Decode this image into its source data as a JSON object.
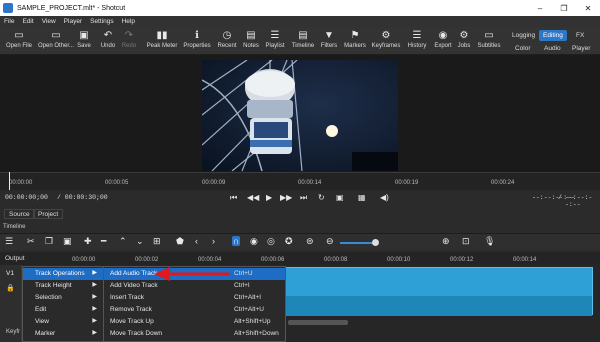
{
  "window": {
    "title": "SAMPLE_PROJECT.mlt* - Shotcut",
    "controls": [
      "–",
      "❐",
      "✕"
    ]
  },
  "menubar": [
    "File",
    "Edit",
    "View",
    "Player",
    "Settings",
    "Help"
  ],
  "toolbar": [
    {
      "label": "Open File",
      "icon": "folder-icon",
      "glyph": "▭"
    },
    {
      "label": "Open Other...",
      "icon": "open-other-icon",
      "glyph": "▭"
    },
    {
      "label": "Save",
      "icon": "save-icon",
      "glyph": "▣"
    },
    {
      "label": "Undo",
      "icon": "undo-icon",
      "glyph": "↶"
    },
    {
      "label": "Redo",
      "icon": "redo-icon",
      "glyph": "↷",
      "disabled": true
    },
    {
      "label": "Peak Meter",
      "icon": "peak-meter-icon",
      "glyph": "▮▮"
    },
    {
      "label": "Properties",
      "icon": "info-icon",
      "glyph": "ℹ"
    },
    {
      "label": "Recent",
      "icon": "clock-icon",
      "glyph": "◷"
    },
    {
      "label": "Notes",
      "icon": "notes-icon",
      "glyph": "▤"
    },
    {
      "label": "Playlist",
      "icon": "playlist-icon",
      "glyph": "☰"
    },
    {
      "label": "Timeline",
      "icon": "timeline-icon",
      "glyph": "▤"
    },
    {
      "label": "Filters",
      "icon": "filter-icon",
      "glyph": "▼"
    },
    {
      "label": "Markers",
      "icon": "marker-icon",
      "glyph": "⚑"
    },
    {
      "label": "Keyframes",
      "icon": "keyframes-icon",
      "glyph": "⚙"
    },
    {
      "label": "History",
      "icon": "history-icon",
      "glyph": "☰"
    },
    {
      "label": "Export",
      "icon": "export-icon",
      "glyph": "◉"
    },
    {
      "label": "Jobs",
      "icon": "gear-icon",
      "glyph": "⚙"
    },
    {
      "label": "Subtitles",
      "icon": "subtitles-icon",
      "glyph": "▭"
    }
  ],
  "layouts": {
    "top": [
      "Logging",
      "Editing",
      "FX"
    ],
    "active": "Editing",
    "bottom": [
      "Color",
      "Audio",
      "Player"
    ]
  },
  "ruler": {
    "ticks": [
      "00:00:00",
      "00:00:05",
      "00:00:09",
      "00:00:14",
      "00:00:19",
      "00:00:24"
    ]
  },
  "transport": {
    "position": "00:00:00;00",
    "duration": "/ 00:00:30;00",
    "in_point": "--:--:--:--",
    "out_point": "--:--:--:--",
    "separator": "/"
  },
  "source_tabs": [
    "Source",
    "Project"
  ],
  "timeline": {
    "label": "Timeline",
    "output_label": "Output",
    "track_name": "V1",
    "keyframes_label": "Keyfr",
    "ticks": [
      "00:00:00",
      "00:00:02",
      "00:00:04",
      "00:00:06",
      "00:00:08",
      "00:00:10",
      "00:00:12",
      "00:00:14"
    ]
  },
  "context_menu": [
    {
      "label": "Track Operations",
      "selected": true
    },
    {
      "label": "Track Height"
    },
    {
      "label": "Selection"
    },
    {
      "label": "Edit"
    },
    {
      "label": "View"
    },
    {
      "label": "Marker"
    }
  ],
  "submenu": [
    {
      "label": "Add Audio Track",
      "shortcut": "Ctrl+U",
      "selected": true
    },
    {
      "label": "Add Video Track",
      "shortcut": "Ctrl+I"
    },
    {
      "label": "Insert Track",
      "shortcut": "Ctrl+Alt+I"
    },
    {
      "label": "Remove Track",
      "shortcut": "Ctrl+Alt+U"
    },
    {
      "label": "Move Track Up",
      "shortcut": "Alt+Shift+Up"
    },
    {
      "label": "Move Track Down",
      "shortcut": "Alt+Shift+Down"
    }
  ],
  "colors": {
    "accent": "#1e6cc4",
    "clip": "#2ea0d6",
    "annotation_arrow": "#e0191f"
  }
}
